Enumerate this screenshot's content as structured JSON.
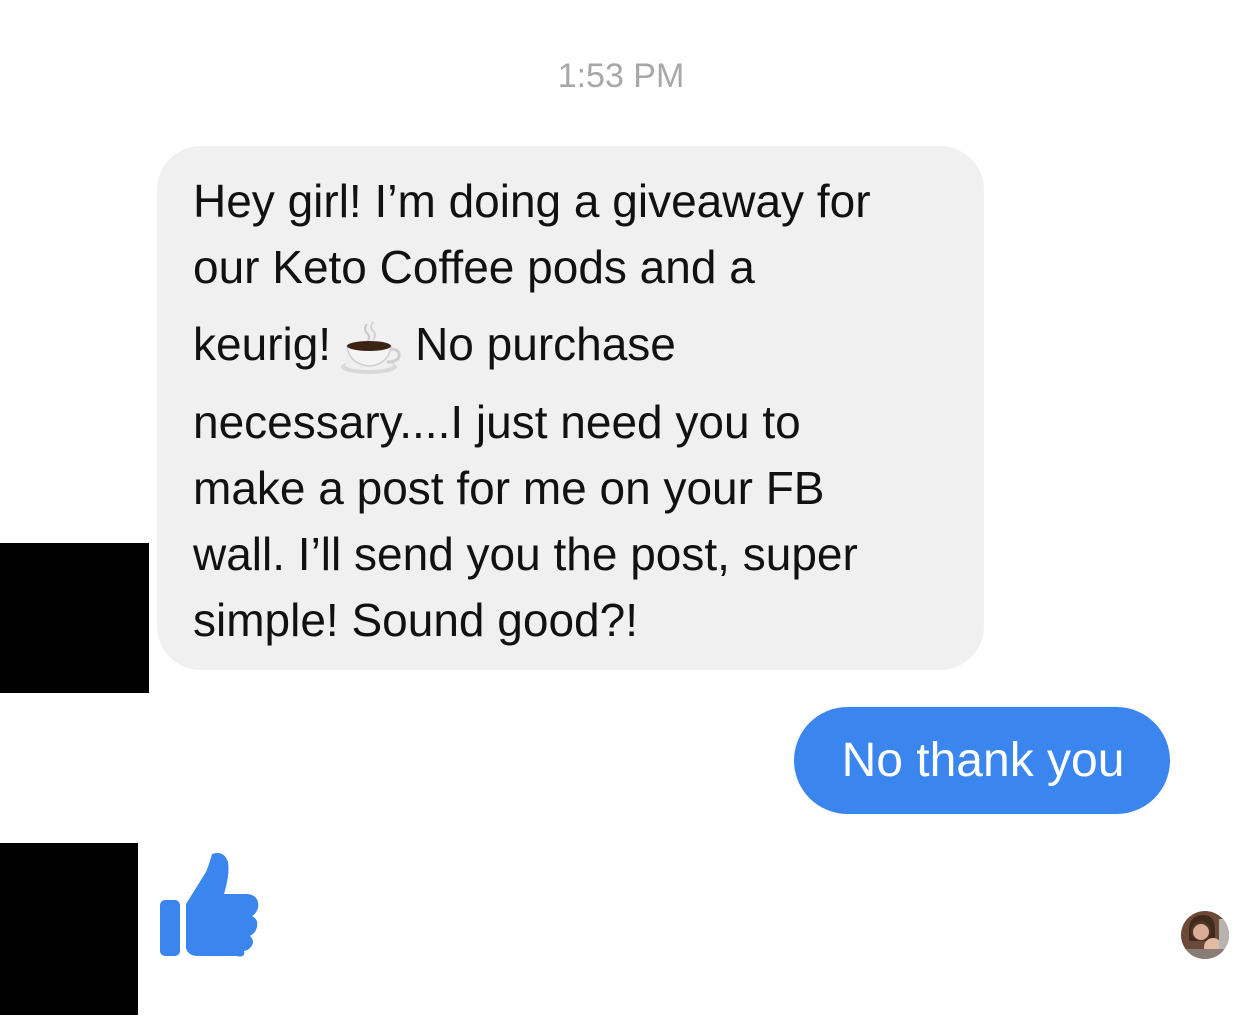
{
  "conversation": {
    "timestamp": "1:53 PM",
    "incoming_message": {
      "lines": [
        "Hey girl! I’m doing a giveaway for",
        "our Keto Coffee pods and a",
        "keurig!",
        "No purchase",
        "necessary....I just need you to",
        "make a post for me on your FB",
        "wall. I’ll send you the post, super",
        "simple! Sound good?!"
      ],
      "emoji": "coffee-cup"
    },
    "outgoing_message": {
      "text": "No thank you"
    },
    "reaction": {
      "icon": "thumbs-up-icon"
    },
    "read_receipt": {
      "icon": "avatar"
    }
  },
  "colors": {
    "outgoing_bubble": "#3a86ee",
    "incoming_bubble": "#f0f0f0",
    "timestamp_text": "#a8a8ab",
    "thumbs_up": "#3a86ee"
  }
}
